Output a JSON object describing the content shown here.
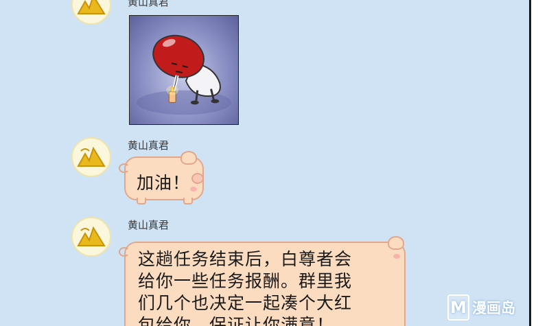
{
  "chat": {
    "messages": [
      {
        "sender": "黄山真君",
        "type": "sticker",
        "sticker_icon": "red-capsule-candle-sticker"
      },
      {
        "sender": "黄山真君",
        "type": "text",
        "text": "加油！"
      },
      {
        "sender": "黄山真君",
        "type": "text",
        "text": "这趟任务结束后，白尊者会\n给你一些任务报酬。群里我\n们几个也决定一起凑个大红\n包给你，保证让你满意！"
      }
    ]
  },
  "watermark": {
    "letter": "M",
    "text": "漫画岛"
  },
  "colors": {
    "background": "#cfe3f5",
    "bubble": "#fbdcc1",
    "bubble_border": "#e2a78a",
    "avatar_gold": "#e8b81c"
  }
}
